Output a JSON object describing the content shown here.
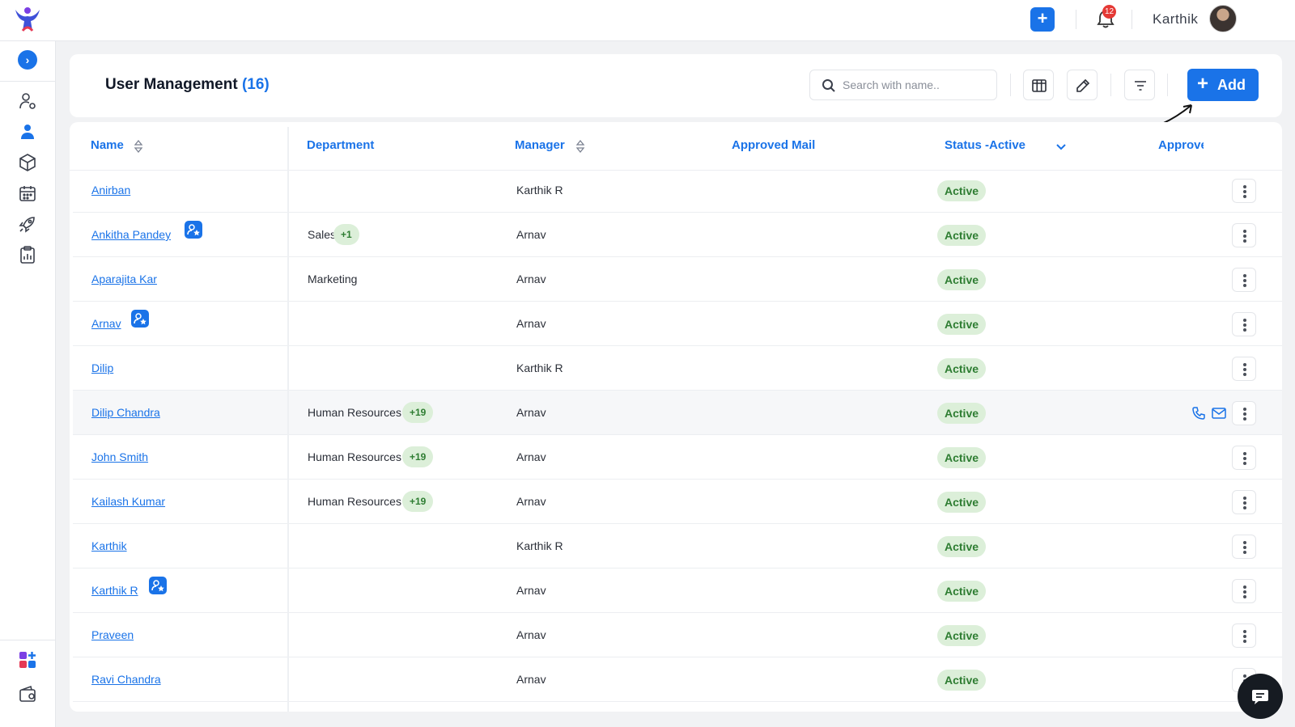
{
  "topbar": {
    "notification_count": "12",
    "username": "Karthik"
  },
  "page": {
    "title": "User Management",
    "count": "(16)"
  },
  "search": {
    "placeholder": "Search with name.."
  },
  "toolbar": {
    "add_label": "Add"
  },
  "table": {
    "headers": {
      "name": "Name",
      "department": "Department",
      "manager": "Manager",
      "approved_mail": "Approved Mail",
      "status": "Status -Active",
      "approved": "Approve"
    },
    "rows": [
      {
        "name": "Anirban",
        "admin": false,
        "department": "",
        "dept_more": "",
        "manager": "Karthik R",
        "status": "Active"
      },
      {
        "name": "Ankitha Pandey",
        "admin": true,
        "department": "Sales",
        "dept_more": "+1",
        "manager": "Arnav",
        "status": "Active"
      },
      {
        "name": "Aparajita Kar",
        "admin": false,
        "department": "Marketing",
        "dept_more": "",
        "manager": "Arnav",
        "status": "Active"
      },
      {
        "name": "Arnav",
        "admin": true,
        "department": "",
        "dept_more": "",
        "manager": "Arnav",
        "status": "Active"
      },
      {
        "name": "Dilip",
        "admin": false,
        "department": "",
        "dept_more": "",
        "manager": "Karthik R",
        "status": "Active"
      },
      {
        "name": "Dilip Chandra",
        "admin": false,
        "department": "Human Resources",
        "dept_more": "+19",
        "manager": "Arnav",
        "status": "Active"
      },
      {
        "name": "John Smith",
        "admin": false,
        "department": "Human Resources",
        "dept_more": "+19",
        "manager": "Arnav",
        "status": "Active"
      },
      {
        "name": "Kailash Kumar",
        "admin": false,
        "department": "Human Resources",
        "dept_more": "+19",
        "manager": "Arnav",
        "status": "Active"
      },
      {
        "name": "Karthik",
        "admin": false,
        "department": "",
        "dept_more": "",
        "manager": "Karthik R",
        "status": "Active"
      },
      {
        "name": "Karthik R",
        "admin": true,
        "department": "",
        "dept_more": "",
        "manager": "Arnav",
        "status": "Active"
      },
      {
        "name": "Praveen",
        "admin": false,
        "department": "",
        "dept_more": "",
        "manager": "Arnav",
        "status": "Active"
      },
      {
        "name": "Ravi Chandra",
        "admin": false,
        "department": "",
        "dept_more": "",
        "manager": "Arnav",
        "status": "Active"
      }
    ]
  },
  "colors": {
    "accent": "#1a73e8",
    "status_bg": "#dcefd9",
    "status_text": "#2e7d32"
  }
}
